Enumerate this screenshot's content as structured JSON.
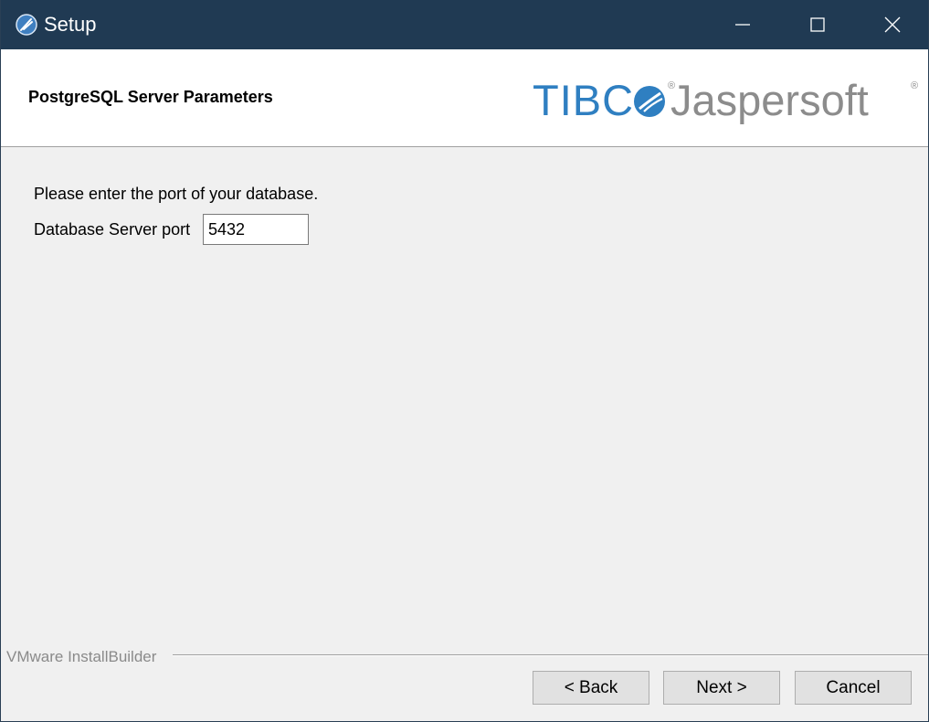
{
  "window": {
    "title": "Setup",
    "app_icon": "feather-icon",
    "controls": {
      "minimize_icon": "minimize-icon",
      "maximize_icon": "maximize-icon",
      "close_icon": "close-icon"
    }
  },
  "header": {
    "title": "PostgreSQL Server Parameters",
    "logo": {
      "part1": "TIBC",
      "part2": "Jaspersoft",
      "reg_mark": "®",
      "tibco_color": "#2f7fc1",
      "jaspersoft_color": "#8c8c8c"
    }
  },
  "main": {
    "instructions": "Please enter the port of your database.",
    "port_label": "Database Server port",
    "port_value": "5432"
  },
  "footer": {
    "brand": "VMware InstallBuilder",
    "back_label": "< Back",
    "next_label": "Next >",
    "cancel_label": "Cancel"
  },
  "colors": {
    "titlebar": "#203a53",
    "background": "#f0f0f0",
    "button_face": "#e1e1e1"
  }
}
